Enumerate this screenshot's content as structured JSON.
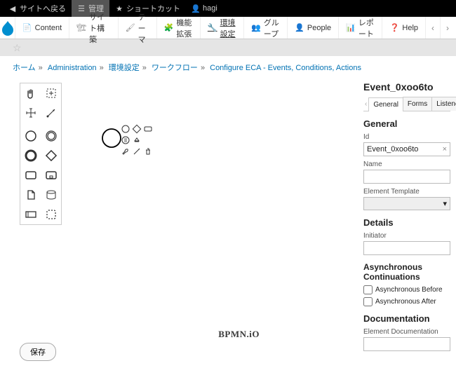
{
  "topbar": {
    "back": "サイトへ戻る",
    "manage": "管理",
    "shortcuts": "ショートカット",
    "user": "hagi"
  },
  "adminmenu": {
    "content": "Content",
    "structure": "サイト構築",
    "theme": "テーマ",
    "extend": "機能拡張",
    "config": "環境設定",
    "groups": "グループ",
    "people": "People",
    "reports": "レポート",
    "help": "Help"
  },
  "crumbs": {
    "home": "ホーム",
    "admin": "Administration",
    "config": "環境設定",
    "workflow": "ワークフロー",
    "last": "Configure ECA - Events, Conditions, Actions"
  },
  "save": "保存",
  "watermark": "BPMN.iO",
  "panel": {
    "title": "Event_0xoo6to",
    "tabs": {
      "general": "General",
      "forms": "Forms",
      "listeners": "Listene"
    },
    "general": "General",
    "id_label": "Id",
    "id_value": "Event_0xoo6to",
    "name_label": "Name",
    "name_value": "",
    "template_label": "Element Template",
    "details": "Details",
    "initiator_label": "Initiator",
    "initiator_value": "",
    "async_title": "Asynchronous Continuations",
    "async_before": "Asynchronous Before",
    "async_after": "Asynchronous After",
    "doc": "Documentation",
    "doc_label": "Element Documentation",
    "doc_value": ""
  },
  "chart_data": null
}
